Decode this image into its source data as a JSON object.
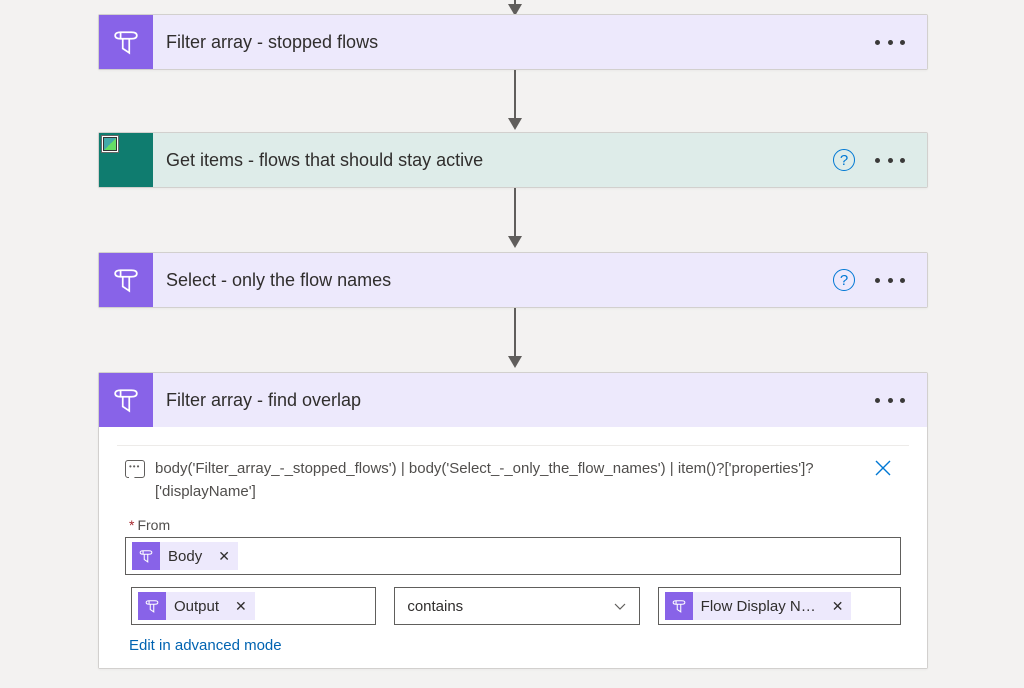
{
  "cards": {
    "filter_stopped": {
      "title": "Filter array - stopped flows"
    },
    "get_items": {
      "title": "Get items - flows that should stay active"
    },
    "select_names": {
      "title": "Select - only the flow names"
    },
    "filter_overlap": {
      "title": "Filter array - find overlap"
    }
  },
  "overlap_body": {
    "peek_expression": "body('Filter_array_-_stopped_flows') | body('Select_-_only_the_flow_names') | item()?['properties']?['displayName']",
    "from_label": "From",
    "from_token": "Body",
    "cond_left_token": "Output",
    "cond_operator": "contains",
    "cond_right_token": "Flow Display N…",
    "advanced_link": "Edit in advanced mode"
  }
}
